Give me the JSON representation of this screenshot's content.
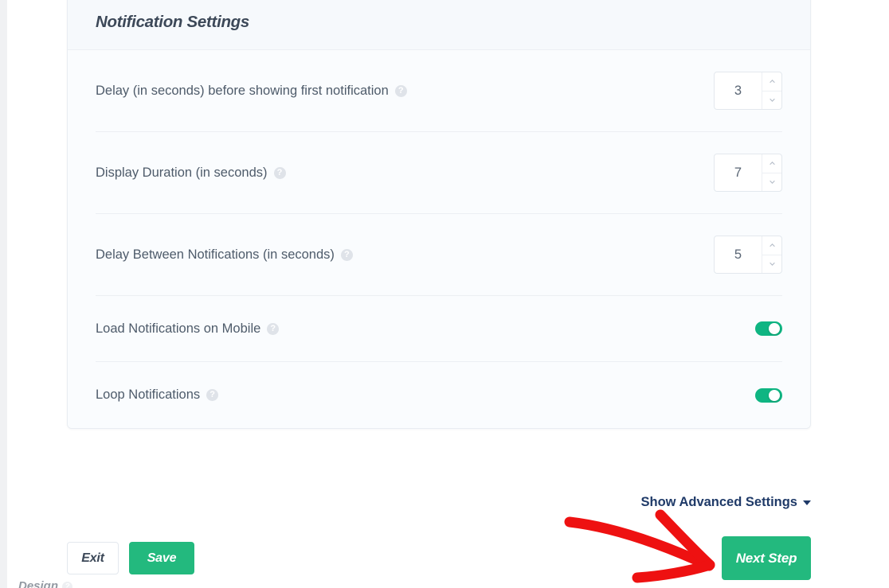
{
  "panel": {
    "title": "Notification Settings",
    "rows": [
      {
        "label": "Delay (in seconds) before showing first notification",
        "help_icon": "help-circle-icon",
        "control": "number",
        "value": "3"
      },
      {
        "label": "Display Duration (in seconds)",
        "help_icon": "help-circle-icon",
        "control": "number",
        "value": "7"
      },
      {
        "label": "Delay Between Notifications (in seconds)",
        "help_icon": "help-circle-icon",
        "control": "number",
        "value": "5"
      },
      {
        "label": "Load Notifications on Mobile",
        "help_icon": "help-circle-icon",
        "control": "toggle",
        "value": "on"
      },
      {
        "label": "Loop Notifications",
        "help_icon": "help-circle-icon",
        "control": "toggle",
        "value": "on"
      }
    ]
  },
  "advanced": {
    "label": "Show Advanced Settings",
    "caret_icon": "caret-down-icon"
  },
  "footer": {
    "exit_label": "Exit",
    "save_label": "Save",
    "next_label": "Next Step"
  },
  "annotation": {
    "type": "red-arrow",
    "points_to": "Next Step",
    "color": "#ee1111"
  },
  "cutoff": {
    "text": "Design"
  },
  "colors": {
    "accent_green": "#23b97e",
    "toggle_green": "#0fb582",
    "link_navy": "#1f3a68",
    "label_grey": "#4e5b6a",
    "panel_bg": "#f9fbfd",
    "annotation_red": "#ee1111"
  },
  "help_glyph": "?"
}
